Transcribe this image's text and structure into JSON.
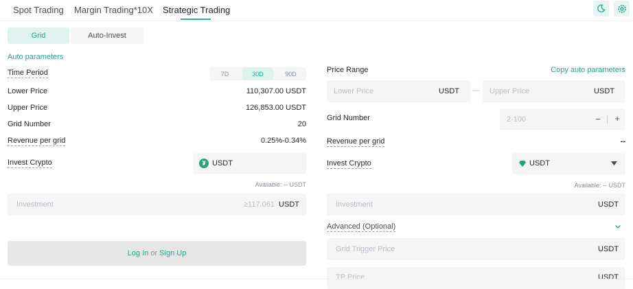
{
  "tabs": [
    {
      "label": "Spot Trading"
    },
    {
      "label": "Margin Trading*10X"
    },
    {
      "label": "Strategic Trading"
    }
  ],
  "icons": {
    "left": "moon-icon",
    "right": "settings-icon"
  },
  "colors": {
    "accent": "#21a58b",
    "accent_bg": "#dff3ee"
  },
  "mode_tabs": {
    "grid": "Grid",
    "auto_invest": "Auto-Invest"
  },
  "left": {
    "auto_parameters": "Auto parameters",
    "time_period_label": "Time Period",
    "periods": [
      "7D",
      "30D",
      "90D"
    ],
    "selected_period": "30D",
    "lower_price_label": "Lower Price",
    "lower_price_value": "110,307.00 USDT",
    "upper_price_label": "Upper Price",
    "upper_price_value": "126,853.00 USDT",
    "grid_number_label": "Grid Number",
    "grid_number_value": "20",
    "revenue_label": "Revenue per grid",
    "revenue_value": "0.25%-0.34%",
    "invest_crypto_label": "Invest Crypto",
    "invest_crypto_value": "USDT",
    "available": "Available: -- USDT",
    "investment_placeholder": "Investment",
    "investment_min": "≥117.061",
    "investment_unit": "USDT",
    "login_text": "Log In",
    "or_text": "or",
    "signup_text": "Sign Up"
  },
  "right": {
    "price_range_label": "Price Range",
    "copy_auto": "Copy auto parameters",
    "lower_price_placeholder": "Lower Price",
    "lower_unit": "USDT",
    "range_separator": "—",
    "upper_price_placeholder": "Upper Price",
    "upper_unit": "USDT",
    "grid_number_label": "Grid Number",
    "grid_number_placeholder": "2-100",
    "minus": "−",
    "plus": "+",
    "revenue_label": "Revenue per grid",
    "revenue_value": "--",
    "invest_crypto_label": "Invest Crypto",
    "invest_crypto_value": "USDT",
    "available": "Available: -- USDT",
    "investment_placeholder": "Investment",
    "investment_unit": "USDT",
    "advanced_label": "Advanced (Optional)",
    "trigger_placeholder": "Grid Trigger Price",
    "trigger_unit": "USDT",
    "tp_placeholder": "TP Price",
    "tp_unit": "USDT"
  }
}
